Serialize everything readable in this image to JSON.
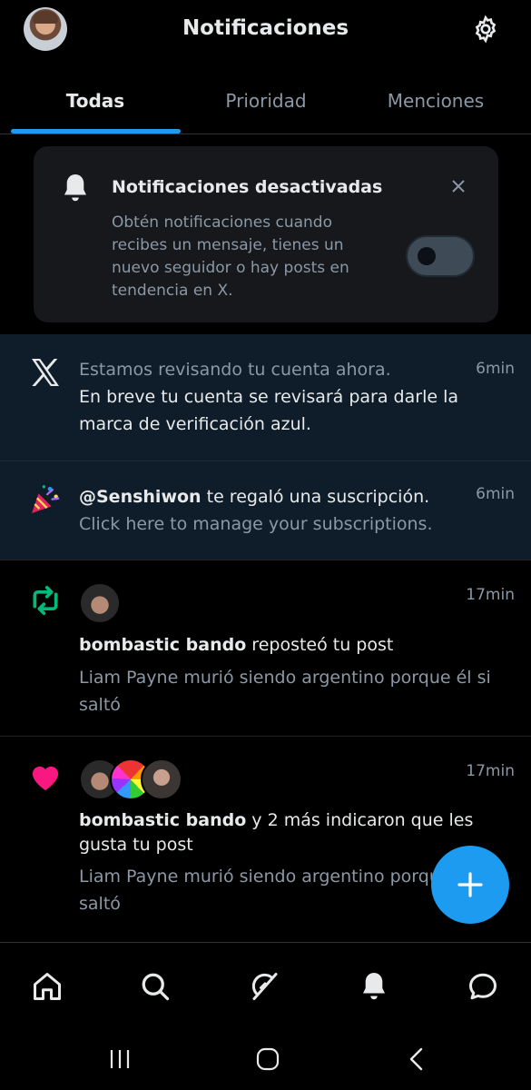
{
  "header": {
    "title": "Notificaciones"
  },
  "tabs": [
    {
      "label": "Todas",
      "active": true
    },
    {
      "label": "Prioridad",
      "active": false
    },
    {
      "label": "Menciones",
      "active": false
    }
  ],
  "banner": {
    "title": "Notificaciones desactivadas",
    "body": "Obtén notificaciones cuando recibes un mensaje, tienes un nuevo seguidor o hay posts en tendencia en X.",
    "toggle_on": false
  },
  "notifications": [
    {
      "icon": "x-logo-icon",
      "time": "6min",
      "line1": "Estamos revisando tu cuenta ahora.",
      "line2": "En breve tu cuenta se revisará para darle la marca de verificación azul."
    },
    {
      "icon": "party-popper-icon",
      "time": "6min",
      "user": "@Senshiwon",
      "action": " te regaló una suscripción.",
      "line2": "Click here to manage your subscriptions."
    },
    {
      "icon": "repost-icon",
      "time": "17min",
      "user": "bombastic bando",
      "action": " reposteó tu post",
      "snippet": "Liam Payne murió siendo argentino porque él si saltó"
    },
    {
      "icon": "heart-icon",
      "time": "17min",
      "user": "bombastic bando",
      "action": " y 2 más indicaron que les gusta tu post",
      "snippet": "Liam Payne murió siendo argentino porque él si saltó"
    }
  ],
  "colors": {
    "accent": "#1d9bf0",
    "repost": "#00ba7c",
    "like": "#f91880",
    "highlight_bg": "#0e1d29"
  },
  "bottom_nav": [
    "home-icon",
    "search-icon",
    "grok-icon",
    "notifications-icon",
    "messages-icon"
  ]
}
